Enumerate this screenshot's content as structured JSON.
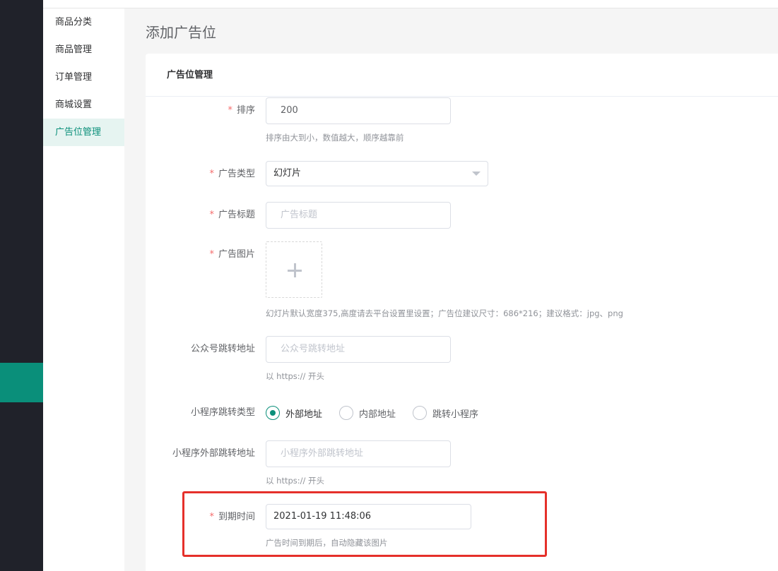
{
  "submenu": {
    "items": [
      {
        "label": "商品分类",
        "active": false
      },
      {
        "label": "商品管理",
        "active": false
      },
      {
        "label": "订单管理",
        "active": false
      },
      {
        "label": "商城设置",
        "active": false
      },
      {
        "label": "广告位管理",
        "active": true
      }
    ]
  },
  "page": {
    "title": "添加广告位"
  },
  "card": {
    "header": "广告位管理"
  },
  "form": {
    "sort": {
      "label": "排序",
      "required": true,
      "value": "200",
      "hint": "排序由大到小，数值越大，顺序越靠前"
    },
    "ad_type": {
      "label": "广告类型",
      "required": true,
      "value": "幻灯片"
    },
    "ad_title": {
      "label": "广告标题",
      "required": true,
      "value": "",
      "placeholder": "广告标题"
    },
    "ad_image": {
      "label": "广告图片",
      "required": true,
      "hint": "幻灯片默认宽度375,高度请去平台设置里设置；广告位建议尺寸：686*216；建议格式：jpg、png"
    },
    "mp_url": {
      "label": "公众号跳转地址",
      "required": false,
      "value": "",
      "placeholder": "公众号跳转地址",
      "hint": "以 https:// 开头"
    },
    "mini_jump_type": {
      "label": "小程序跳转类型",
      "required": false,
      "options": [
        {
          "label": "外部地址",
          "checked": true
        },
        {
          "label": "内部地址",
          "checked": false
        },
        {
          "label": "跳转小程序",
          "checked": false
        }
      ]
    },
    "mini_ext_url": {
      "label": "小程序外部跳转地址",
      "required": false,
      "value": "",
      "placeholder": "小程序外部跳转地址",
      "hint": "以 https:// 开头"
    },
    "expire_time": {
      "label": "到期时间",
      "required": true,
      "value": "2021-01-19 11:48:06",
      "hint": "广告时间到期后，自动隐藏该图片"
    }
  },
  "colors": {
    "accent": "#0a8f7a",
    "required_star": "#f56c6c",
    "highlight": "#e5302a",
    "sidebar_bg": "#20222a"
  }
}
